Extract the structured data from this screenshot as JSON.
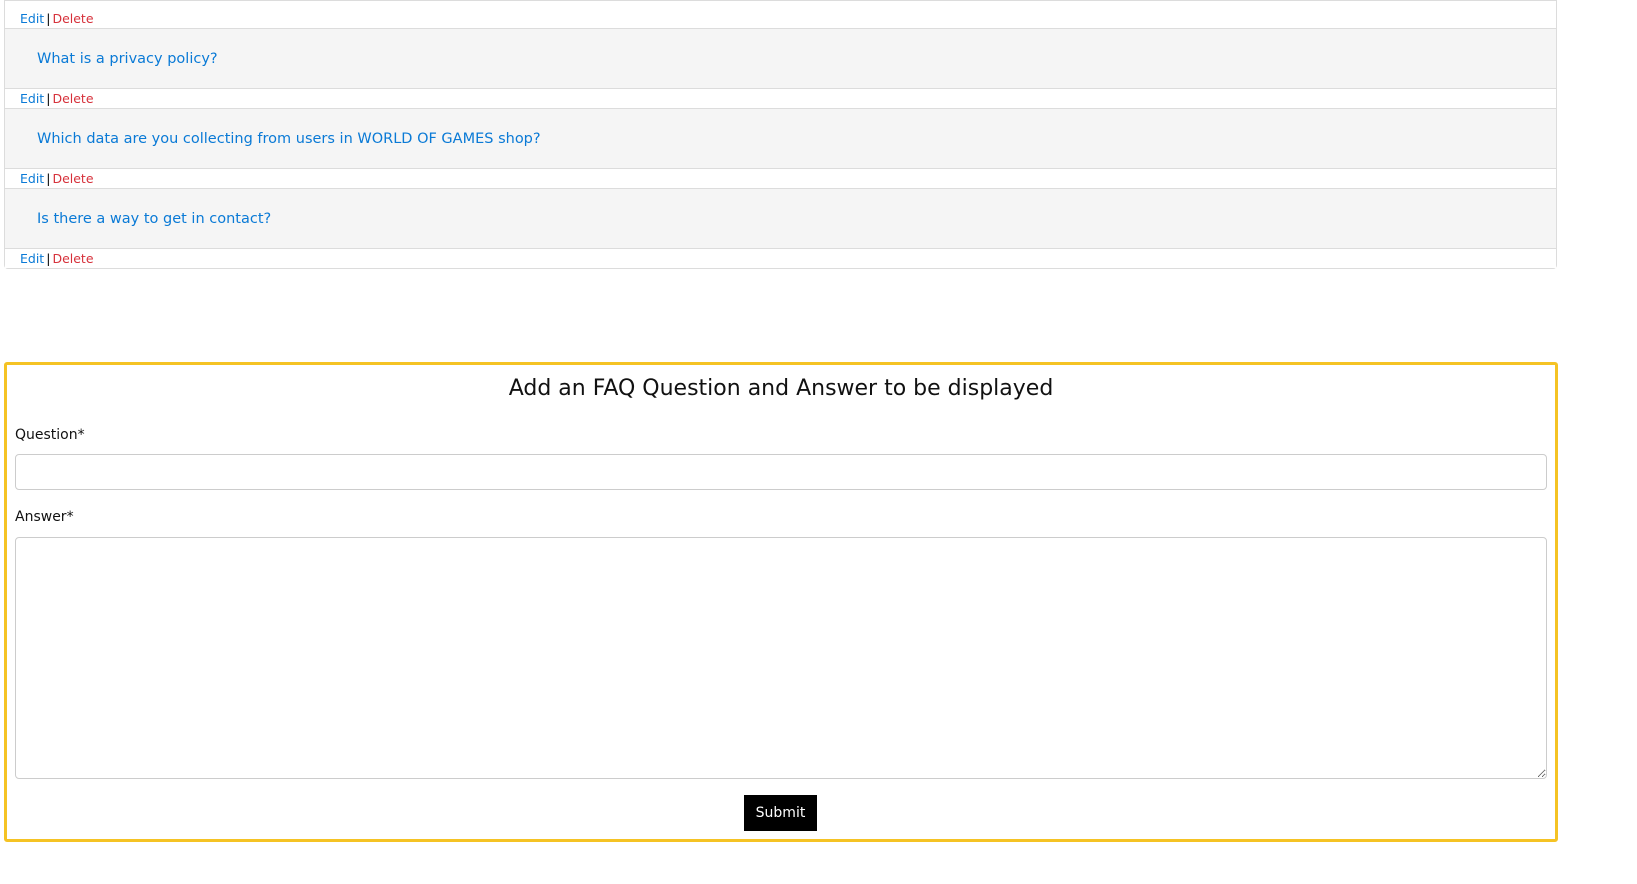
{
  "faq": {
    "actions": {
      "edit_label": "Edit",
      "separator": "|",
      "delete_label": "Delete"
    },
    "items": [
      {
        "question": "What is a privacy policy?"
      },
      {
        "question": "Which data are you collecting from users in WORLD OF GAMES shop?"
      },
      {
        "question": "Is there a way to get in contact?"
      }
    ]
  },
  "add_form": {
    "title": "Add an FAQ Question and Answer to be displayed",
    "question_label": "Question*",
    "question_value": "",
    "answer_label": "Answer*",
    "answer_value": "",
    "submit_label": "Submit",
    "accent_color": "#f5c324"
  },
  "colors": {
    "link": "#0a7ad6",
    "delete": "#d6303a",
    "row_bg": "#f5f5f5"
  }
}
